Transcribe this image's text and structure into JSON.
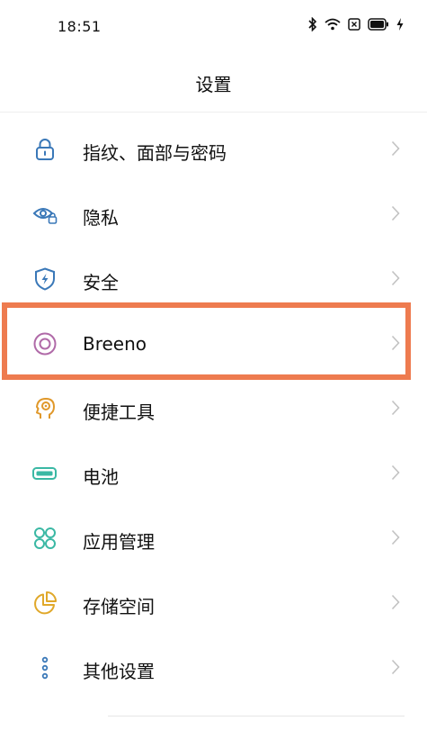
{
  "status_bar": {
    "time": "18:51",
    "icons": [
      "bluetooth-icon",
      "wifi-icon",
      "sim-card-icon",
      "battery-icon",
      "charging-icon"
    ]
  },
  "header": {
    "title": "设置"
  },
  "settings": {
    "items": [
      {
        "label": "指纹、面部与密码",
        "icon": "lock-icon",
        "color": "#3a78b8"
      },
      {
        "label": "隐私",
        "icon": "eye-lock-icon",
        "color": "#3a78b8"
      },
      {
        "label": "安全",
        "icon": "shield-bolt-icon",
        "color": "#3a78b8"
      },
      {
        "label": "Breeno",
        "icon": "breeno-ring-icon",
        "color": "#b06aa8"
      },
      {
        "label": "便捷工具",
        "icon": "head-location-icon",
        "color": "#e0982a"
      },
      {
        "label": "电池",
        "icon": "battery-icon",
        "color": "#3ab8a4"
      },
      {
        "label": "应用管理",
        "icon": "apps-grid-icon",
        "color": "#3ab8a4"
      },
      {
        "label": "存储空间",
        "icon": "pie-chart-icon",
        "color": "#e0a82a"
      },
      {
        "label": "其他设置",
        "icon": "more-dots-icon",
        "color": "#3a78b8"
      }
    ]
  },
  "highlight": {
    "target": "Breeno",
    "color": "#ee7b4f"
  }
}
